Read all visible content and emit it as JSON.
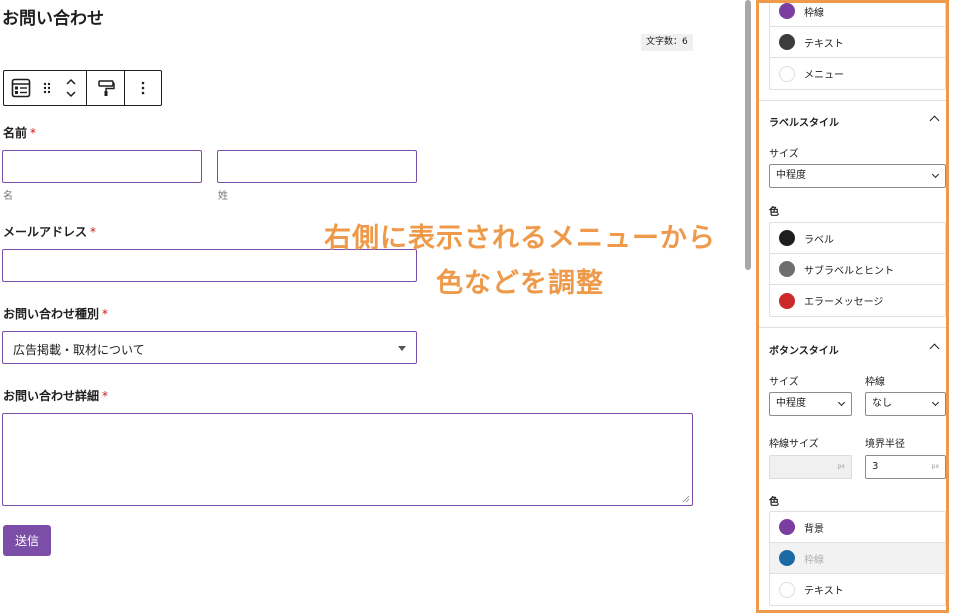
{
  "form": {
    "title": "お問い合わせ",
    "char_count": "文字数：6",
    "required_mark": "*",
    "name": {
      "label": "名前",
      "first_sub": "名",
      "last_sub": "姓"
    },
    "email": {
      "label": "メールアドレス"
    },
    "inquiry_type": {
      "label": "お問い合わせ種別",
      "selected": "広告掲載・取材について"
    },
    "details": {
      "label": "お問い合わせ詳細"
    },
    "submit_label": "送信"
  },
  "annotation": {
    "line1": "右側に表示されるメニューから",
    "line2": "色などを調整"
  },
  "sidebar": {
    "top_colors": [
      {
        "label": "枠線",
        "color": "#7b3ea0"
      },
      {
        "label": "テキスト",
        "color": "#3c3c3c"
      },
      {
        "label": "メニュー",
        "color": ""
      }
    ],
    "label_style": {
      "title": "ラベルスタイル",
      "size_label": "サイズ",
      "size_value": "中程度",
      "color_label": "色",
      "colors": [
        {
          "label": "ラベル",
          "color": "#1e1e1e"
        },
        {
          "label": "サブラベルとヒント",
          "color": "#6e6e6e"
        },
        {
          "label": "エラーメッセージ",
          "color": "#cc2a2a"
        }
      ]
    },
    "button_style": {
      "title": "ボタンスタイル",
      "size_label": "サイズ",
      "size_value": "中程度",
      "border_label": "枠線",
      "border_value": "なし",
      "border_size_label": "枠線サイズ",
      "border_size_unit": "px",
      "radius_label": "境界半径",
      "radius_value": "3",
      "radius_unit": "px",
      "color_label": "色",
      "colors": [
        {
          "label": "背景",
          "color": "#7b3ea0"
        },
        {
          "label": "枠線",
          "color": "#1b6aa5"
        },
        {
          "label": "テキスト",
          "color": ""
        }
      ]
    }
  },
  "theme": {
    "accent": "#7b4fa8",
    "annotation_color": "#ee9a4a",
    "required_color": "#cc1818"
  }
}
